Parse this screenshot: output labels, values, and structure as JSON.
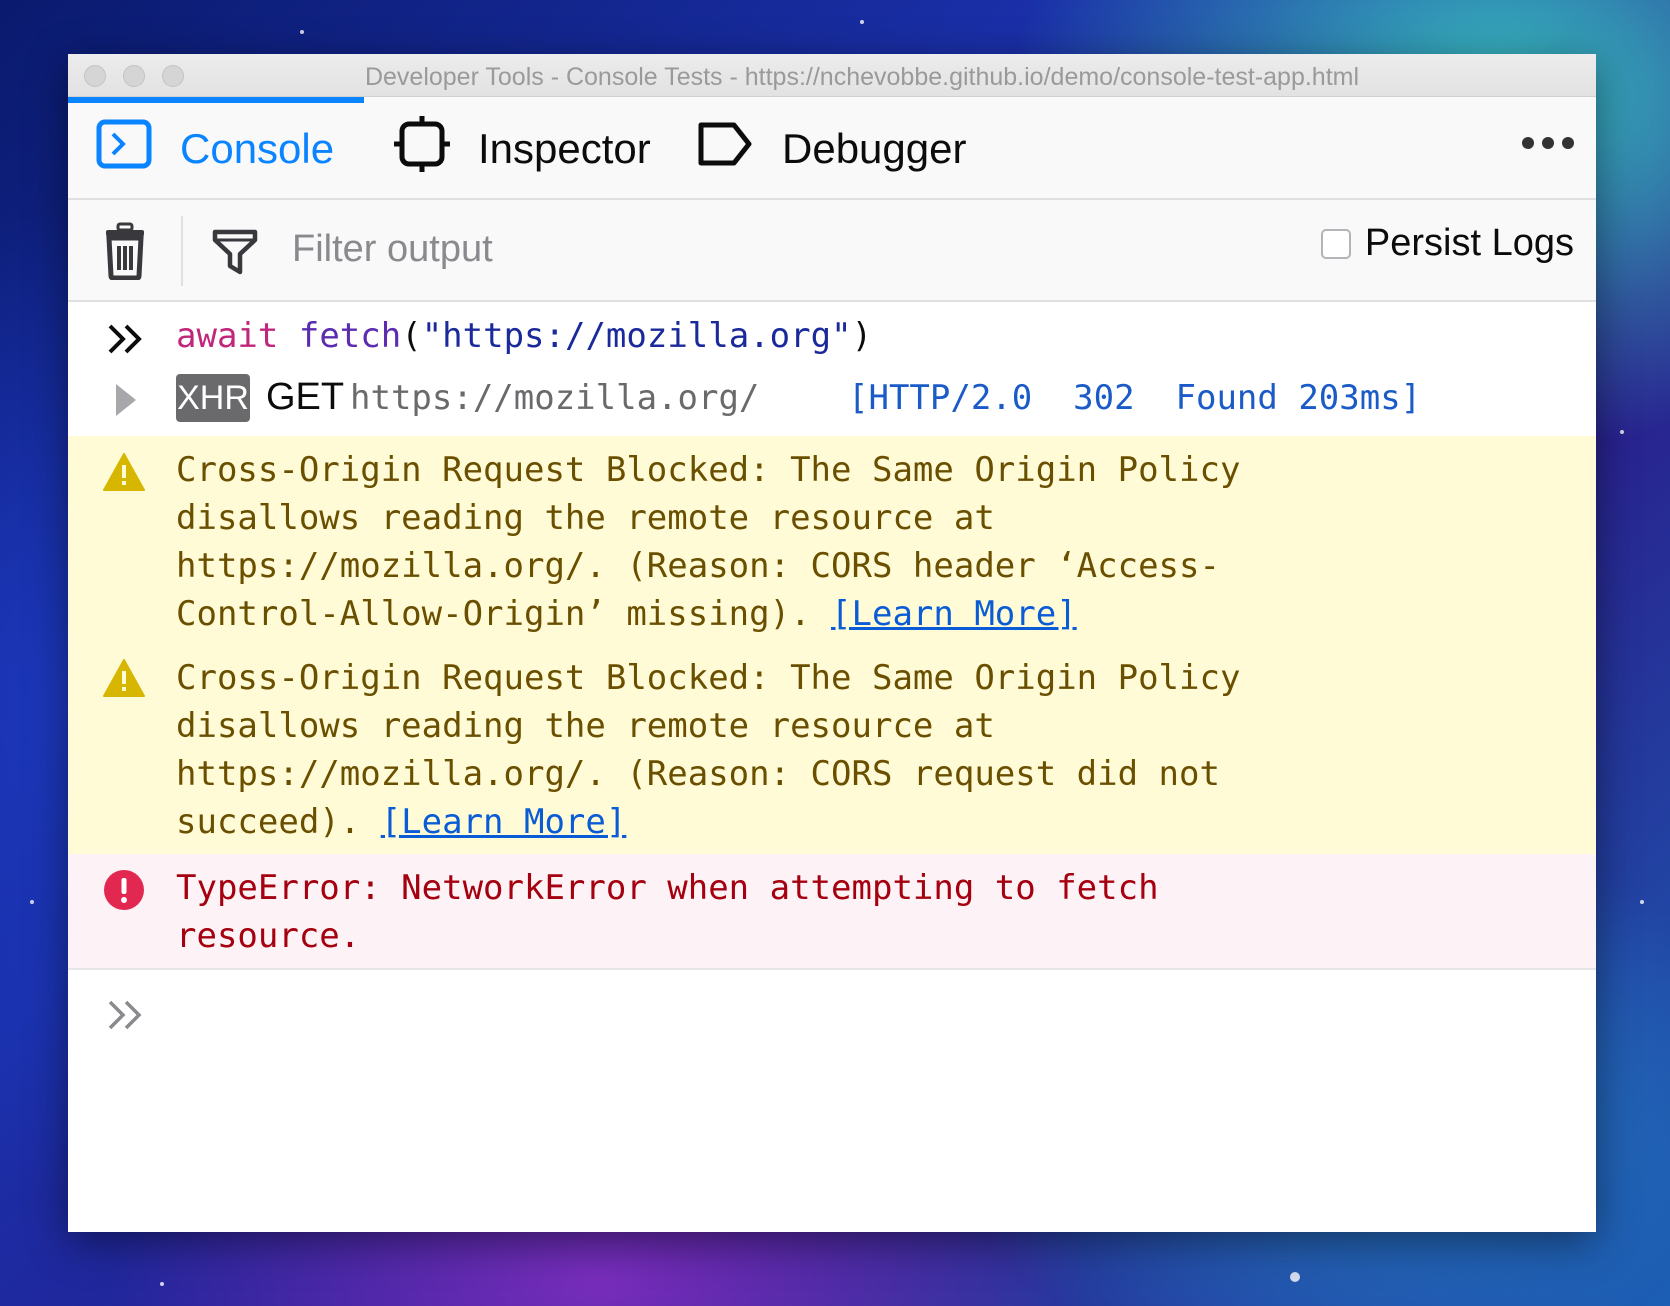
{
  "window": {
    "title": "Developer Tools - Console Tests - https://nchevobbe.github.io/demo/console-test-app.html"
  },
  "tabs": [
    {
      "label": "Console",
      "icon": "console-icon",
      "active": true
    },
    {
      "label": "Inspector",
      "icon": "inspector-icon",
      "active": false
    },
    {
      "label": "Debugger",
      "icon": "debugger-icon",
      "active": false
    }
  ],
  "toolbar": {
    "filter_placeholder": "Filter output",
    "persist_logs_label": "Persist Logs",
    "persist_logs_checked": false
  },
  "console": {
    "input": {
      "keyword": "await",
      "function": "fetch",
      "open_paren": "(",
      "string": "\"https://mozilla.org\"",
      "close_paren": ")"
    },
    "network": {
      "badge": "XHR",
      "method": "GET",
      "url": "https://mozilla.org/",
      "status": "[HTTP/2.0  302  Found 203ms]"
    },
    "warnings": [
      {
        "lines": [
          "Cross-Origin Request Blocked: The Same Origin Policy",
          "disallows reading the remote resource at",
          "https://mozilla.org/. (Reason: CORS header ‘Access-",
          "Control-Allow-Origin’ missing). "
        ],
        "link": "[Learn More]"
      },
      {
        "lines": [
          "Cross-Origin Request Blocked: The Same Origin Policy",
          "disallows reading the remote resource at",
          "https://mozilla.org/. (Reason: CORS request did not",
          "succeed). "
        ],
        "link": "[Learn More]"
      }
    ],
    "error": {
      "lines": [
        "TypeError: NetworkError when attempting to fetch",
        "resource."
      ]
    }
  },
  "colors": {
    "accent": "#0a84ff",
    "warning_bg": "#fffbd6",
    "warning_text": "#6b4f00",
    "error_bg": "#fdf2f5",
    "error_text": "#a4000f",
    "link": "#0a5bd6"
  }
}
